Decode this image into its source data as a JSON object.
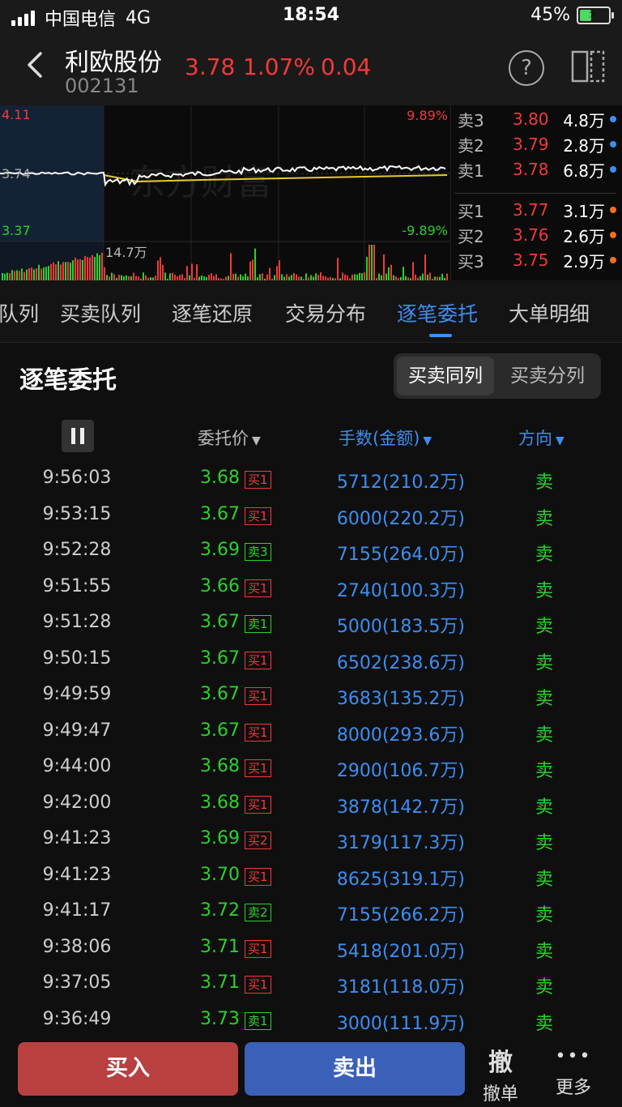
{
  "status_bar": {
    "carrier": "中国电信",
    "network": "4G",
    "time": "18:54",
    "battery": "45%",
    "battery_level": 0.45
  },
  "header": {
    "name": "利欧股份",
    "code": "002131",
    "price": "3.78",
    "change_pct": "1.07%",
    "change": "0.04",
    "help": "?"
  },
  "chart": {
    "high": "4.11",
    "mid": "3.74",
    "low": "3.37",
    "high_pct": "9.89%",
    "low_pct": "-9.89%",
    "volume_label": "14.7万",
    "line_color": "#ffffff",
    "avg_color": "#e6c832"
  },
  "order_book": [
    {
      "label": "卖3",
      "price": "3.80",
      "vol": "4.8万",
      "dot": "#3d8ef0"
    },
    {
      "label": "卖2",
      "price": "3.79",
      "vol": "2.8万",
      "dot": "#3d8ef0"
    },
    {
      "label": "卖1",
      "price": "3.78",
      "vol": "6.8万",
      "dot": "#3d8ef0"
    },
    {
      "label": "买1",
      "price": "3.77",
      "vol": "3.1万",
      "dot": "#f07020"
    },
    {
      "label": "买2",
      "price": "3.76",
      "vol": "2.6万",
      "dot": "#f07020"
    },
    {
      "label": "买3",
      "price": "3.75",
      "vol": "2.9万",
      "dot": "#f07020"
    }
  ],
  "tabs": [
    {
      "label": "队列"
    },
    {
      "label": "买卖队列"
    },
    {
      "label": "逐笔还原"
    },
    {
      "label": "交易分布"
    },
    {
      "label": "逐笔委托",
      "active": true
    },
    {
      "label": "大单明细"
    }
  ],
  "section": {
    "title": "逐笔委托",
    "toggle_on": "买卖同列",
    "toggle_off": "买卖分列"
  },
  "table_header": {
    "price": "委托价",
    "volume": "手数(金额)",
    "direction": "方向"
  },
  "rows": [
    {
      "time": "9:56:03",
      "price": "3.68",
      "tag": "买1",
      "tag_type": "buy",
      "vol": "5712(210.2万)",
      "dir": "卖"
    },
    {
      "time": "9:53:15",
      "price": "3.67",
      "tag": "买1",
      "tag_type": "buy",
      "vol": "6000(220.2万)",
      "dir": "卖"
    },
    {
      "time": "9:52:28",
      "price": "3.69",
      "tag": "卖3",
      "tag_type": "sell",
      "vol": "7155(264.0万)",
      "dir": "卖"
    },
    {
      "time": "9:51:55",
      "price": "3.66",
      "tag": "买1",
      "tag_type": "buy",
      "vol": "2740(100.3万)",
      "dir": "卖"
    },
    {
      "time": "9:51:28",
      "price": "3.67",
      "tag": "卖1",
      "tag_type": "sell",
      "vol": "5000(183.5万)",
      "dir": "卖"
    },
    {
      "time": "9:50:15",
      "price": "3.67",
      "tag": "买1",
      "tag_type": "buy",
      "vol": "6502(238.6万)",
      "dir": "卖"
    },
    {
      "time": "9:49:59",
      "price": "3.67",
      "tag": "买1",
      "tag_type": "buy",
      "vol": "3683(135.2万)",
      "dir": "卖"
    },
    {
      "time": "9:49:47",
      "price": "3.67",
      "tag": "买1",
      "tag_type": "buy",
      "vol": "8000(293.6万)",
      "dir": "卖"
    },
    {
      "time": "9:44:00",
      "price": "3.68",
      "tag": "买1",
      "tag_type": "buy",
      "vol": "2900(106.7万)",
      "dir": "卖"
    },
    {
      "time": "9:42:00",
      "price": "3.68",
      "tag": "买1",
      "tag_type": "buy",
      "vol": "3878(142.7万)",
      "dir": "卖"
    },
    {
      "time": "9:41:23",
      "price": "3.69",
      "tag": "买2",
      "tag_type": "buy",
      "vol": "3179(117.3万)",
      "dir": "卖"
    },
    {
      "time": "9:41:23",
      "price": "3.70",
      "tag": "买1",
      "tag_type": "buy",
      "vol": "8625(319.1万)",
      "dir": "卖"
    },
    {
      "time": "9:41:17",
      "price": "3.72",
      "tag": "卖2",
      "tag_type": "sell",
      "vol": "7155(266.2万)",
      "dir": "卖"
    },
    {
      "time": "9:38:06",
      "price": "3.71",
      "tag": "买1",
      "tag_type": "buy",
      "vol": "5418(201.0万)",
      "dir": "卖"
    },
    {
      "time": "9:37:05",
      "price": "3.71",
      "tag": "买1",
      "tag_type": "buy",
      "vol": "3181(118.0万)",
      "dir": "卖"
    },
    {
      "time": "9:36:49",
      "price": "3.73",
      "tag": "卖1",
      "tag_type": "sell",
      "vol": "3000(111.9万)",
      "dir": "卖"
    }
  ],
  "bottom": {
    "buy": "买入",
    "sell": "卖出",
    "cancel_icon": "撤",
    "cancel": "撤单",
    "more_icon": "•••",
    "more": "更多"
  }
}
